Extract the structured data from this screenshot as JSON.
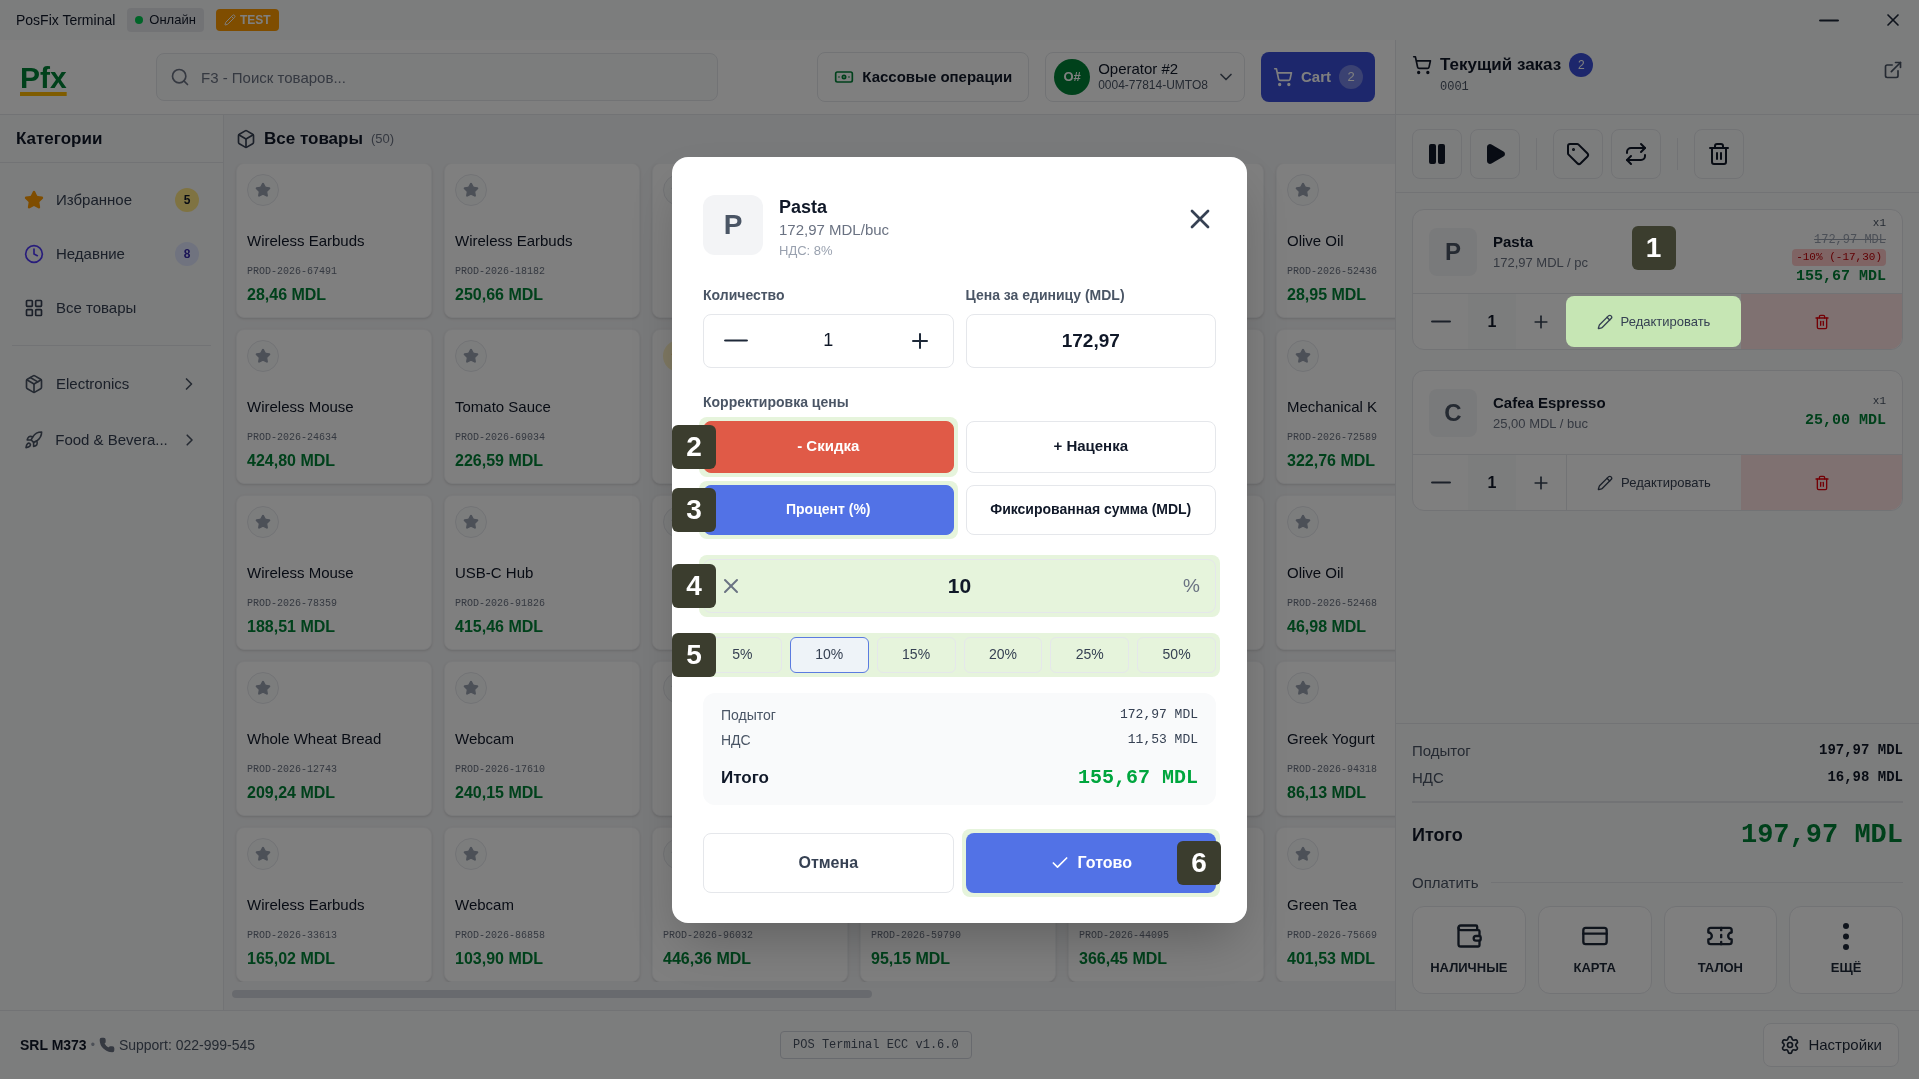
{
  "title_bar": {
    "app_name": "PosFix Terminal",
    "status": {
      "label": "Онлайн",
      "online": true
    },
    "env_badge": "TEST"
  },
  "header": {
    "logo": "Pfx",
    "search": {
      "placeholder": "F3 - Поиск товаров..."
    },
    "cash_button": "Кассовые операции",
    "operator": {
      "initials": "O#",
      "name": "Operator #2",
      "id": "0004-77814-UMTO8"
    },
    "cart_button": {
      "label": "Cart",
      "count": "2"
    }
  },
  "sidebar": {
    "title": "Категории",
    "items": [
      {
        "kind": "favorites",
        "label": "Избранное",
        "badge": "5"
      },
      {
        "kind": "recent",
        "label": "Недавние",
        "badge": "8"
      },
      {
        "kind": "all",
        "label": "Все товары"
      }
    ],
    "categories": [
      {
        "kind": "electronics",
        "label": "Electronics"
      },
      {
        "kind": "food",
        "label": "Food & Bevera..."
      }
    ]
  },
  "catalog": {
    "title": "Все товары",
    "count": "(50)",
    "rows": [
      [
        {
          "favorite": false,
          "name": "Wireless Earbuds",
          "sku": "PROD-2026-67491",
          "price": "28,46 MDL"
        },
        {
          "favorite": false,
          "name": "Wireless Earbuds",
          "sku": "PROD-2026-18182",
          "price": "250,66 MDL"
        },
        {
          "favorite": false
        },
        {},
        {},
        {
          "favorite": false,
          "name": "Olive Oil",
          "sku": "PROD-2026-52436",
          "price": "28,95 MDL"
        }
      ],
      [
        {
          "favorite": false,
          "name": "Wireless Mouse",
          "sku": "PROD-2026-24634",
          "price": "424,80 MDL"
        },
        {
          "favorite": false,
          "name": "Tomato Sauce",
          "sku": "PROD-2026-69034",
          "price": "226,59 MDL"
        },
        {
          "favorite": true
        },
        {},
        {},
        {
          "favorite": false,
          "name": "Mechanical K",
          "sku": "PROD-2026-72589",
          "price": "322,76 MDL"
        }
      ],
      [
        {
          "favorite": false,
          "name": "Wireless Mouse",
          "sku": "PROD-2026-78359",
          "price": "188,51 MDL"
        },
        {
          "favorite": false,
          "name": "USB-C Hub",
          "sku": "PROD-2026-91826",
          "price": "415,46 MDL"
        },
        {
          "favorite": false
        },
        {},
        {},
        {
          "favorite": false,
          "name": "Olive Oil",
          "sku": "PROD-2026-52468",
          "price": "46,98 MDL"
        }
      ],
      [
        {
          "favorite": false,
          "name": "Whole Wheat Bread",
          "sku": "PROD-2026-12743",
          "price": "209,24 MDL"
        },
        {
          "favorite": false,
          "name": "Webcam",
          "sku": "PROD-2026-17610",
          "price": "240,15 MDL"
        },
        {
          "favorite": false
        },
        {},
        {},
        {
          "favorite": false,
          "name": "Greek Yogurt",
          "sku": "PROD-2026-94318",
          "price": "86,13 MDL"
        }
      ],
      [
        {
          "favorite": false,
          "name": "Wireless Earbuds",
          "sku": "PROD-2026-33613",
          "price": "165,02 MDL"
        },
        {
          "favorite": false,
          "name": "Webcam",
          "sku": "PROD-2026-86858",
          "price": "103,90 MDL"
        },
        {
          "favorite": false,
          "sku": "PROD-2026-96032",
          "price": "446,36 MDL"
        },
        {
          "sku": "PROD-2026-59790",
          "price": "95,15 MDL"
        },
        {
          "sku": "PROD-2026-44095",
          "price": "366,45 MDL"
        },
        {
          "favorite": false,
          "name": "Green Tea",
          "sku": "PROD-2026-75669",
          "price": "401,53 MDL"
        }
      ]
    ]
  },
  "order": {
    "title": "Текущий заказ",
    "count": "2",
    "number": "0001",
    "items": [
      {
        "initial": "P",
        "name": "Pasta",
        "unit_price": "172,97 MDL / pc",
        "qty_badge": "x1",
        "old_price": "172,97 MDL",
        "discount": "-10% (-17,30)",
        "price": "155,67 MDL",
        "quantity": "1",
        "edit_label": "Редактировать",
        "callout": "1"
      },
      {
        "initial": "C",
        "name": "Cafea Espresso",
        "unit_price": "25,00 MDL / buc",
        "qty_badge": "x1",
        "price": "25,00 MDL",
        "quantity": "1",
        "edit_label": "Редактировать"
      }
    ],
    "subtotal": {
      "label": "Подытог",
      "value": "197,97 MDL"
    },
    "vat": {
      "label": "НДС",
      "value": "16,98 MDL"
    },
    "total": {
      "label": "Итого",
      "value": "197,97 MDL"
    },
    "pay_label": "Оплатить",
    "payments": [
      {
        "kind": "cash",
        "label": "НАЛИЧНЫЕ"
      },
      {
        "kind": "card",
        "label": "КАРТА"
      },
      {
        "kind": "voucher",
        "label": "ТАЛОН"
      },
      {
        "kind": "more",
        "label": "ЕЩЁ"
      }
    ]
  },
  "footer": {
    "company": "SRL M373",
    "separator": "•",
    "support": "Support: 022-999-545",
    "version": "POS Terminal ECC v1.6.0",
    "settings": "Настройки"
  },
  "dialog": {
    "initial": "P",
    "name": "Pasta",
    "unit_price": "172,97 MDL/buc",
    "vat": "НДС: 8%",
    "quantity_label": "Количество",
    "quantity": "1",
    "price_label": "Цена за единицу (MDL)",
    "price": "172,97",
    "adjust_label": "Корректировка цены",
    "adjust_types": [
      {
        "kind": "discount",
        "label": "- Скидка",
        "selected": true,
        "callout": "2"
      },
      {
        "kind": "markup",
        "label": "+ Наценка",
        "selected": false
      }
    ],
    "modes": [
      {
        "label": "Процент (%)",
        "selected": true,
        "callout": "3"
      },
      {
        "label": "Фиксированная сумма (MDL)",
        "selected": false
      }
    ],
    "amount": {
      "value": "10",
      "unit": "%",
      "callout": "4"
    },
    "presets": {
      "callout": "5",
      "items": [
        {
          "label": "5%",
          "selected": false
        },
        {
          "label": "10%",
          "selected": true
        },
        {
          "label": "15%",
          "selected": false
        },
        {
          "label": "20%",
          "selected": false
        },
        {
          "label": "25%",
          "selected": false
        },
        {
          "label": "50%",
          "selected": false
        }
      ]
    },
    "subtotal": {
      "label": "Подытог",
      "value": "172,97 MDL"
    },
    "vat_line": {
      "label": "НДС",
      "value": "11,53 MDL"
    },
    "total": {
      "label": "Итого",
      "value": "155,67 MDL"
    },
    "cancel": "Отмена",
    "confirm": {
      "label": "Готово",
      "callout": "6"
    }
  }
}
